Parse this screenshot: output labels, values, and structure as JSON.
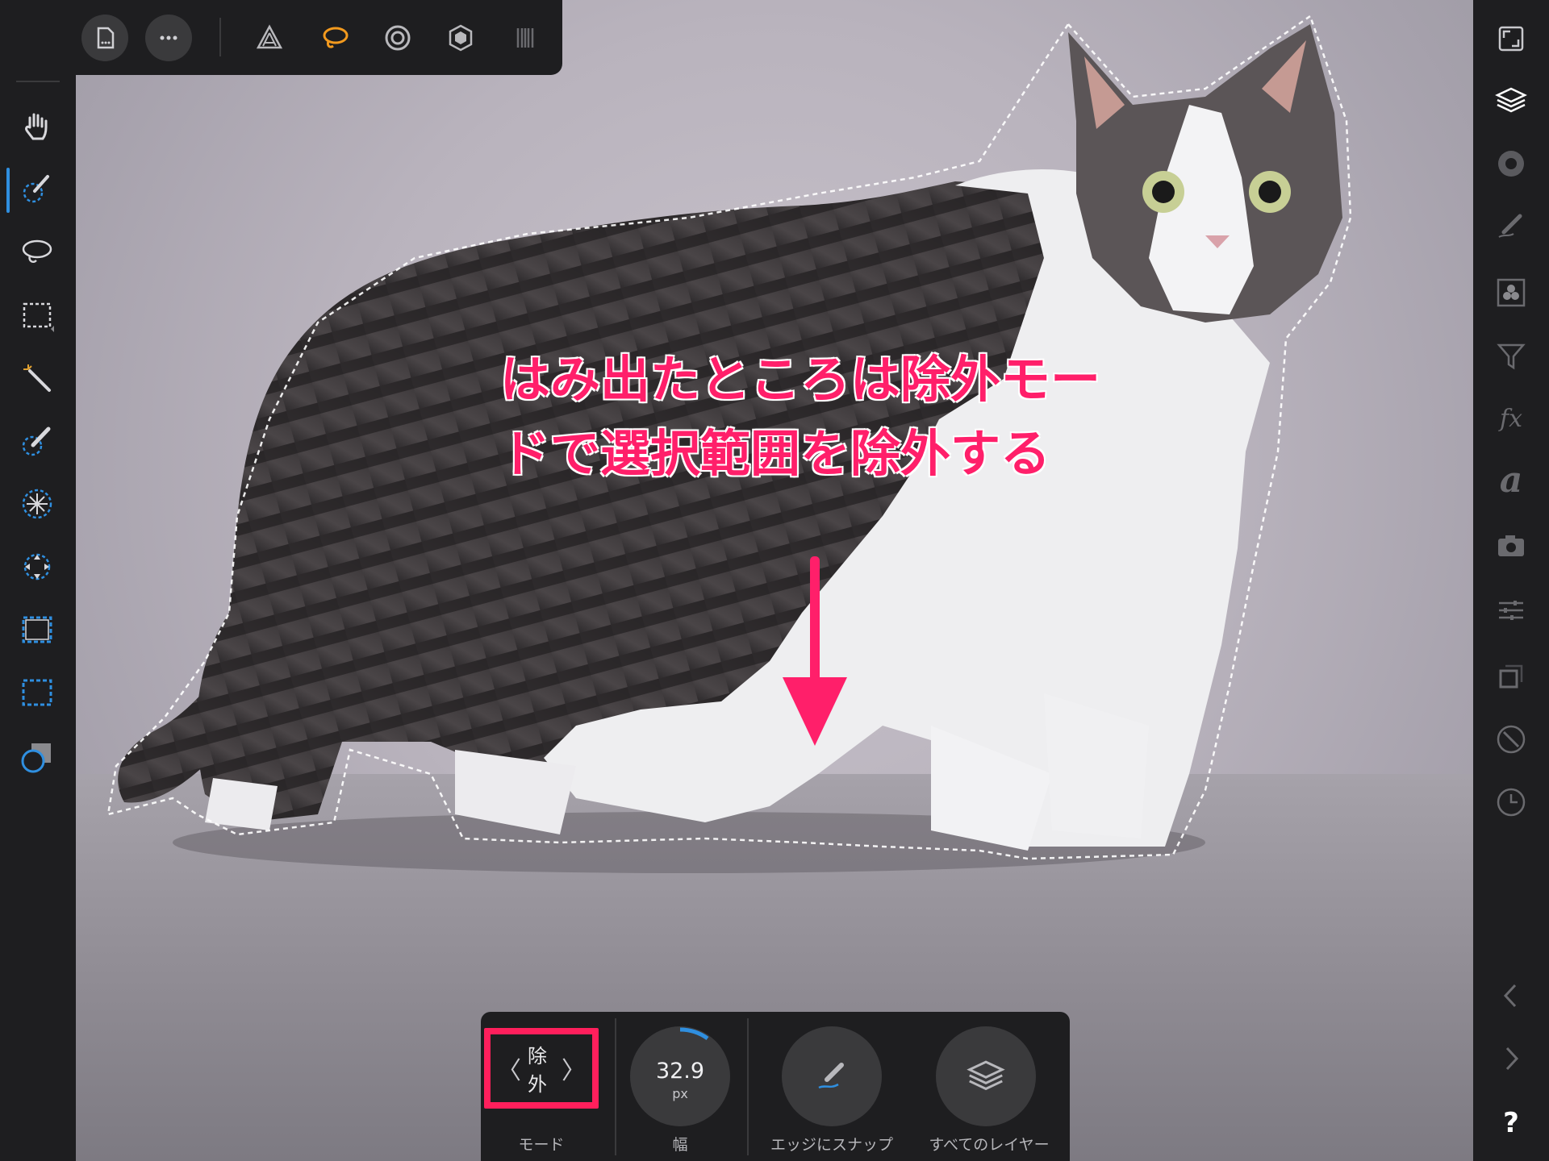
{
  "annotation": {
    "line1": "はみ出たところは除外モー",
    "line2": "ドで選択範囲を除外する"
  },
  "context_toolbar": {
    "mode_value": "除外",
    "mode_label": "モード",
    "width_value": "32.9",
    "width_unit": "px",
    "width_label": "幅",
    "snap_label": "エッジにスナップ",
    "all_layers_label": "すべてのレイヤー",
    "chevron_left": "〈",
    "chevron_right": "〉"
  },
  "right_panel": {
    "fx_label": "fx",
    "character_label": "a",
    "help_label": "?"
  },
  "colors": {
    "accent": "#2f8fe0",
    "annotation": "#ff1f6a",
    "highlight_box": "#ff1f5c",
    "active_persona": "#f39a1e"
  },
  "icons": {
    "top": [
      "back-arrow-icon",
      "document-icon",
      "more-icon",
      "photo-persona-icon",
      "liquify-persona-icon",
      "develop-persona-icon",
      "tone-mapping-persona-icon",
      "export-persona-icon"
    ],
    "left": [
      "hand-icon",
      "selection-brush-icon",
      "freehand-selection-icon",
      "marquee-selection-icon",
      "flood-select-icon",
      "refine-brush-icon",
      "radial-icon",
      "transform-icon",
      "rect-marquee-icon",
      "rect-marquee-blue-icon",
      "color-select-icon"
    ],
    "right": [
      "fullscreen-icon",
      "layers-icon",
      "color-icon",
      "brushes-icon",
      "channels-icon",
      "filter-icon",
      "fx-icon",
      "character-icon",
      "camera-icon",
      "adjustments-icon",
      "transform-panel-icon",
      "navigator-icon",
      "history-icon",
      "prev-icon",
      "next-icon",
      "help-icon"
    ]
  }
}
